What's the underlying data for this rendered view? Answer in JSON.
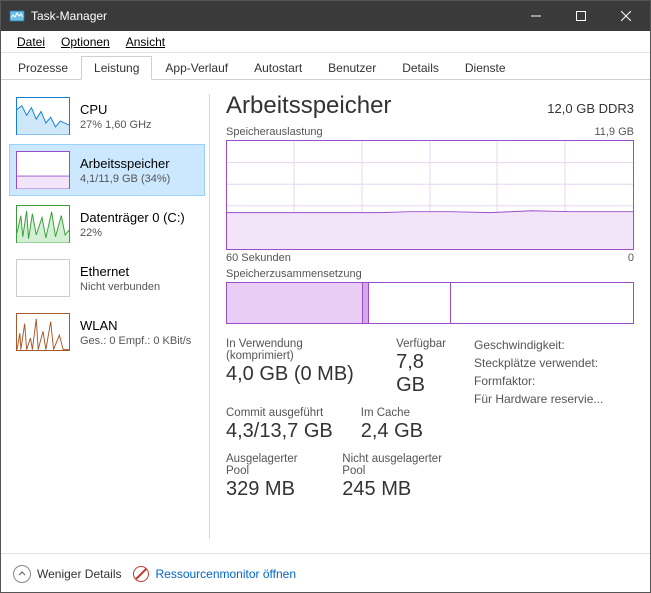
{
  "window": {
    "title": "Task-Manager"
  },
  "menu": {
    "file": "Datei",
    "options": "Optionen",
    "view": "Ansicht"
  },
  "tabs": {
    "processes": "Prozesse",
    "performance": "Leistung",
    "app_history": "App-Verlauf",
    "startup": "Autostart",
    "users": "Benutzer",
    "details": "Details",
    "services": "Dienste"
  },
  "sidebar": {
    "cpu": {
      "label": "CPU",
      "sub": "27% 1,60 GHz"
    },
    "memory": {
      "label": "Arbeitsspeicher",
      "sub": "4,1/11,9 GB (34%)"
    },
    "disk": {
      "label": "Datenträger 0 (C:)",
      "sub": "22%"
    },
    "ethernet": {
      "label": "Ethernet",
      "sub": "Nicht verbunden"
    },
    "wlan": {
      "label": "WLAN",
      "sub": "Ges.: 0 Empf.: 0 KBit/s"
    }
  },
  "main": {
    "title": "Arbeitsspeicher",
    "meta": "12,0 GB DDR3",
    "graph1_left": "Speicherauslastung",
    "graph1_right": "11,9 GB",
    "axis_left": "60 Sekunden",
    "axis_right": "0",
    "graph2_label": "Speicherzusammensetzung",
    "stats": {
      "in_use_k": "In Verwendung (komprimiert)",
      "in_use_v": "4,0 GB (0 MB)",
      "avail_k": "Verfügbar",
      "avail_v": "7,8 GB",
      "commit_k": "Commit ausgeführt",
      "commit_v": "4,3/13,7 GB",
      "cached_k": "Im Cache",
      "cached_v": "2,4 GB",
      "paged_k": "Ausgelagerter Pool",
      "paged_v": "329 MB",
      "nonpaged_k": "Nicht ausgelagerter Pool",
      "nonpaged_v": "245 MB"
    },
    "rightcol": {
      "speed": "Geschwindigkeit:",
      "slots": "Steckplätze verwendet:",
      "form": "Formfaktor:",
      "reserved": "Für Hardware reservie..."
    }
  },
  "footer": {
    "fewer": "Weniger Details",
    "resmon": "Ressourcenmonitor öffnen"
  },
  "chart_data": {
    "type": "line",
    "title": "Speicherauslastung",
    "ylabel": "GB",
    "xlabel": "Sekunden",
    "ylim": [
      0,
      11.9
    ],
    "xlim": [
      60,
      0
    ],
    "x": [
      60,
      55,
      50,
      45,
      40,
      35,
      30,
      25,
      20,
      15,
      10,
      5,
      0
    ],
    "values": [
      4.0,
      4.0,
      4.0,
      4.0,
      4.0,
      4.1,
      4.1,
      4.0,
      4.1,
      4.1,
      4.1,
      4.1,
      4.1
    ],
    "composition_gb": {
      "in_use": 4.0,
      "modified": 0.07,
      "standby": 2.4,
      "free": 5.4,
      "total": 11.9
    }
  }
}
